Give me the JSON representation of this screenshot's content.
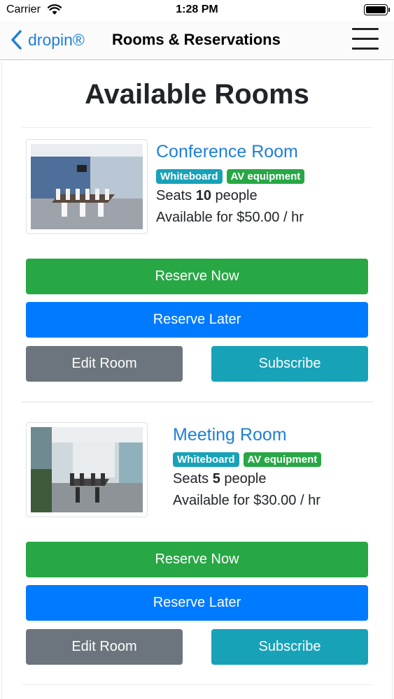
{
  "status_bar": {
    "carrier": "Carrier",
    "time": "1:28 PM"
  },
  "nav": {
    "back_label": "dropin®",
    "title": "Rooms & Reservations"
  },
  "page": {
    "title": "Available Rooms"
  },
  "rooms": [
    {
      "name": "Conference Room",
      "badges": [
        "Whiteboard",
        "AV equipment"
      ],
      "seats_prefix": "Seats ",
      "seats_count": "10",
      "seats_suffix": " people",
      "price": "Available for $50.00 / hr",
      "buttons": {
        "reserve_now": "Reserve Now",
        "reserve_later": "Reserve Later",
        "edit": "Edit Room",
        "subscribe": "Subscribe"
      }
    },
    {
      "name": "Meeting Room",
      "badges": [
        "Whiteboard",
        "AV equipment"
      ],
      "seats_prefix": "Seats ",
      "seats_count": "5",
      "seats_suffix": " people",
      "price": "Available for $30.00 / hr",
      "buttons": {
        "reserve_now": "Reserve Now",
        "reserve_later": "Reserve Later",
        "edit": "Edit Room",
        "subscribe": "Subscribe"
      }
    }
  ],
  "colors": {
    "link": "#1e7fd8",
    "success": "#28a745",
    "primary": "#007bff",
    "secondary": "#6c757d",
    "info": "#17a2b8"
  }
}
